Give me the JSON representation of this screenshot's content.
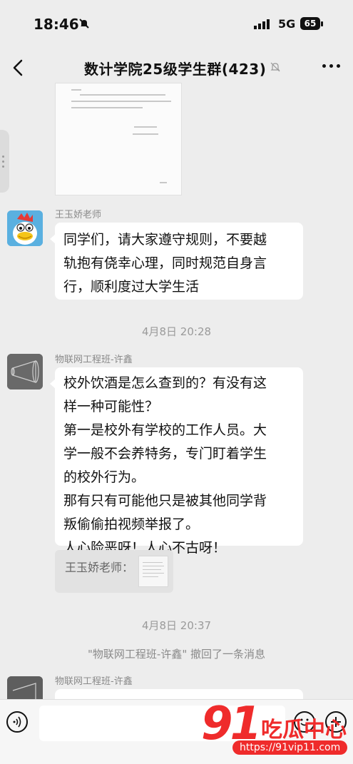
{
  "status_bar": {
    "time": "18:46",
    "network": "5G",
    "battery": "65"
  },
  "header": {
    "title": "数计学院25级学生群(423)",
    "icons": [
      "back-icon",
      "bell-off-icon",
      "more-icon"
    ]
  },
  "messages": {
    "m1": {
      "sender": "王玉娇老师",
      "text": "同学们，请大家遵守规则，不要越\n轨抱有侥幸心理，同时规范自身言\n行，顺利度过大学生活"
    },
    "sep1": "4月8日 20:28",
    "m2": {
      "sender": "物联网工程班-许鑫",
      "text": "校外饮酒是怎么查到的？有没有这\n样一种可能性？\n第一是校外有学校的工作人员。大\n学一般不会养特务，专门盯着学生\n的校外行为。\n那有只有可能他只是被其他同学背\n叛偷偷拍视频举报了。\n人心险恶呀！人心不古呀！",
      "quote": "王玉娇老师："
    },
    "sep2": "4月8日 20:37",
    "recall": "\"物联网工程班-许鑫\" 撤回了一条消息",
    "m3": {
      "sender": "物联网工程班-许鑫"
    }
  },
  "input_bar": {
    "icons": [
      "voice-icon",
      "emoji-icon",
      "plus-icon"
    ]
  },
  "watermark": {
    "number": "91",
    "brand": "吃瓜中心",
    "url": "https://91vip11.com"
  },
  "colors": {
    "background": "#ededed",
    "bubble": "#ffffff",
    "watermark": "#ef2b2b"
  }
}
